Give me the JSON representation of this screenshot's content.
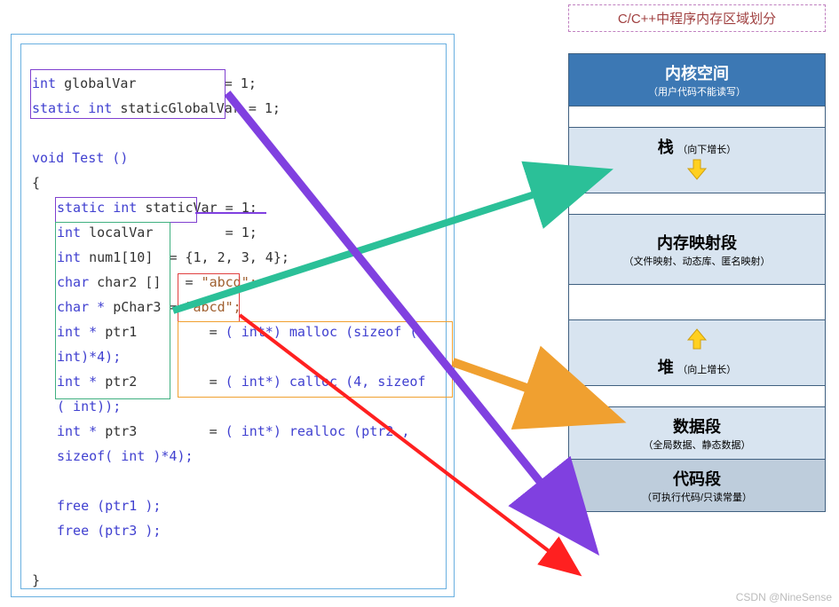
{
  "title": "C/C++中程序内存区域划分",
  "code": {
    "globalVar": {
      "type": "int",
      "name": "globalVar",
      "val": "= 1;"
    },
    "staticGlobalVar": {
      "type": "static int",
      "name": "staticGlobalVar",
      "val": "= 1;"
    },
    "funcSig": "void Test ()",
    "lbrace": "{",
    "staticVar": {
      "type": "static int",
      "name": "staticVar",
      "val": "= 1;"
    },
    "localVar": {
      "type": "int",
      "name": "localVar",
      "val": "= 1;"
    },
    "num1": {
      "type": "int",
      "name": "num1[10]",
      "val": "= {1, 2, 3, 4};"
    },
    "char2": {
      "type": "char",
      "name": "char2 []",
      "eq": "=",
      "str": "\"abcd\";"
    },
    "pChar3": {
      "type": "char *",
      "name": "pChar3",
      "eq": "=",
      "str": "\"abcd\";"
    },
    "ptr1": {
      "type": "int *",
      "name": "ptr1",
      "eq": "=",
      "cast": "( int*)",
      "call": "malloc (sizeof ( int)*4);"
    },
    "ptr2": {
      "type": "int *",
      "name": "ptr2",
      "eq": "=",
      "cast": "( int*)",
      "call": "calloc (4, sizeof ( int));"
    },
    "ptr3": {
      "type": "int *",
      "name": "ptr3",
      "eq": "=",
      "cast": "( int*)",
      "call": "realloc (ptr2 , sizeof( int )*4);"
    },
    "free1": "free (ptr1 );",
    "free3": "free (ptr3 );",
    "rbrace": "}"
  },
  "memory": {
    "kernel": {
      "big": "内核空间",
      "small": "（用户代码不能读写）"
    },
    "stack": {
      "big": "栈",
      "small": "（向下增长）"
    },
    "mmap": {
      "big": "内存映射段",
      "small": "（文件映射、动态库、匿名映射）"
    },
    "heap": {
      "big": "堆",
      "small": "（向上增长）"
    },
    "dataseg": {
      "big": "数据段",
      "small": "（全局数据、静态数据）"
    },
    "codeseg": {
      "big": "代码段",
      "small": "（可执行代码/只读常量）"
    }
  },
  "watermark": "CSDN @NineSense",
  "colors": {
    "arrow_stack": "#2bc098",
    "arrow_heap": "#f0a030",
    "arrow_data": "#8040e0",
    "arrow_code": "#ff2020",
    "yellow_grow": "#ffd020"
  }
}
